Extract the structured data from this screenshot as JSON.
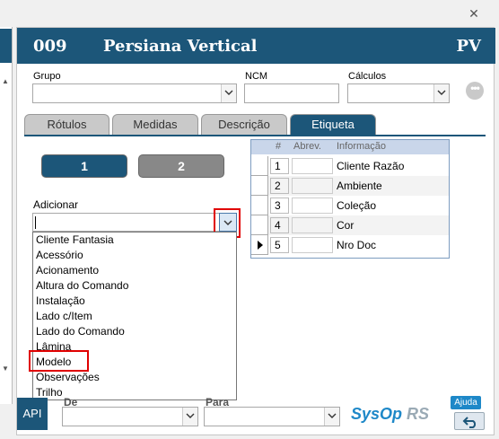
{
  "window": {
    "close_glyph": "✕"
  },
  "header": {
    "code": "009",
    "title": "Persiana Vertical",
    "badge": "PV"
  },
  "labels": {
    "grupo": "Grupo",
    "ncm": "NCM",
    "calculos": "Cálculos",
    "adicionar": "Adicionar",
    "de": "De",
    "para": "Para"
  },
  "tabs": [
    {
      "label": "Rótulos",
      "active": false
    },
    {
      "label": "Medidas",
      "active": false
    },
    {
      "label": "Descrição",
      "active": false
    },
    {
      "label": "Etiqueta",
      "active": true
    }
  ],
  "pages": {
    "one": "1",
    "two": "2"
  },
  "adicionar_options": [
    "Cliente Fantasia",
    "Acessório",
    "Acionamento",
    "Altura do Comando",
    "Instalação",
    "Lado c/Item",
    "Lado do Comando",
    "Lâmina",
    "Modelo",
    "Observações",
    "Trilho"
  ],
  "grid": {
    "columns": {
      "num": "#",
      "abrev": "Abrev.",
      "info": "Informação"
    },
    "rows": [
      {
        "num": "1",
        "info": "Cliente Razão"
      },
      {
        "num": "2",
        "info": "Ambiente"
      },
      {
        "num": "3",
        "info": "Coleção"
      },
      {
        "num": "4",
        "info": "Cor"
      },
      {
        "num": "5",
        "info": "Nro Doc"
      }
    ]
  },
  "footer": {
    "api": "API",
    "brand": "SysOp",
    "brand_suffix": "RS",
    "ajuda": "Ajuda"
  },
  "colors": {
    "primary": "#1c5679",
    "accent": "#1e88c8",
    "highlight": "#e00000"
  }
}
